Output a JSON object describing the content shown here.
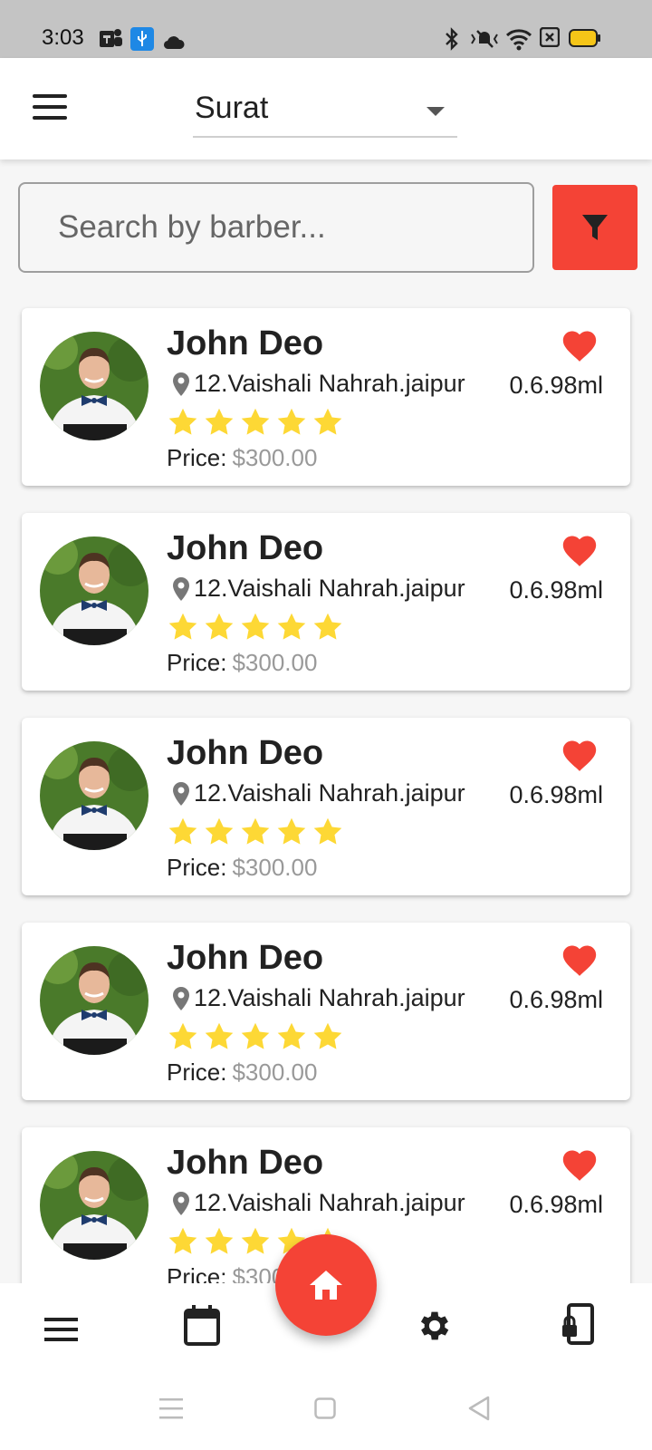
{
  "status_bar": {
    "time": "3:03",
    "left_icons": [
      "teams-icon",
      "usb-icon",
      "cloud-icon"
    ],
    "right_icons": [
      "bluetooth-icon",
      "vibrate-icon",
      "wifi-icon",
      "sim-icon",
      "battery-icon"
    ],
    "battery_color": "#f5c518"
  },
  "app_bar": {
    "city": "Surat"
  },
  "search": {
    "placeholder": "Search by barber..."
  },
  "colors": {
    "accent": "#f44336",
    "star": "#fdd835",
    "heart": "#f44336"
  },
  "barbers": [
    {
      "name": "John Deo",
      "address": "12.Vaishali Nahrah.jaipur",
      "distance": "0.6.98ml",
      "price_label": "Price:",
      "price": "$300.00",
      "rating": 5,
      "favorite": true
    },
    {
      "name": "John Deo",
      "address": "12.Vaishali Nahrah.jaipur",
      "distance": "0.6.98ml",
      "price_label": "Price:",
      "price": "$300.00",
      "rating": 5,
      "favorite": true
    },
    {
      "name": "John Deo",
      "address": "12.Vaishali Nahrah.jaipur",
      "distance": "0.6.98ml",
      "price_label": "Price:",
      "price": "$300.00",
      "rating": 5,
      "favorite": true
    },
    {
      "name": "John Deo",
      "address": "12.Vaishali Nahrah.jaipur",
      "distance": "0.6.98ml",
      "price_label": "Price:",
      "price": "$300.00",
      "rating": 5,
      "favorite": true
    },
    {
      "name": "John Deo",
      "address": "12.Vaishali Nahrah.jaipur",
      "distance": "0.6.98ml",
      "price_label": "Price:",
      "price": "$300.00",
      "rating": 5,
      "favorite": true
    }
  ],
  "bottom_nav": {
    "items": [
      "menu-icon",
      "calendar-icon",
      "home-icon",
      "settings-icon",
      "phone-lock-icon"
    ]
  },
  "system_nav": {
    "items": [
      "recents-icon",
      "home-square-icon",
      "back-icon"
    ]
  }
}
